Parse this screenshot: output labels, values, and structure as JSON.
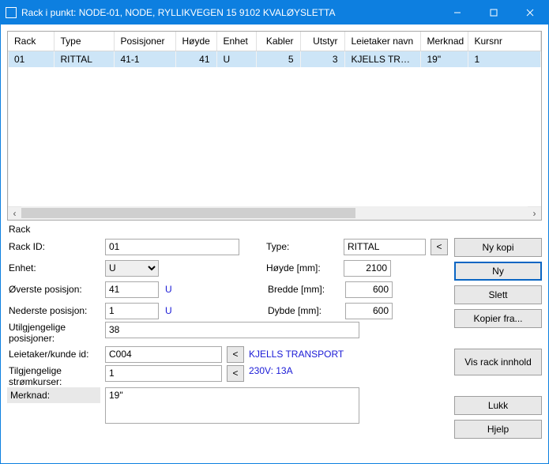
{
  "window": {
    "title": "Rack i punkt: NODE-01, NODE, RYLLIKVEGEN   15 9102 KVALØYSLETTA"
  },
  "grid": {
    "headers": [
      "Rack",
      "Type",
      "Posisjoner",
      "Høyde",
      "Enhet",
      "Kabler",
      "Utstyr",
      "Leietaker navn",
      "Merknad",
      "Kursnr"
    ],
    "row": {
      "rack": "01",
      "type": "RITTAL",
      "posisjoner": "41-1",
      "hoyde": "41",
      "enhet": "U",
      "kabler": "5",
      "utstyr": "3",
      "leietaker": "KJELLS TRAN...",
      "merknad": "19\"",
      "kursnr": "1"
    }
  },
  "labels": {
    "section": "Rack",
    "rack_id": "Rack ID:",
    "enhet": "Enhet:",
    "overste": "Øverste posisjon:",
    "nederste": "Nederste posisjon:",
    "utilgjengelige": "Utilgjengelige posisjoner:",
    "leietaker": "Leietaker/kunde id:",
    "stromkurser": "Tilgjengelige strømkurser:",
    "merknad": "Merknad:",
    "type": "Type:",
    "hoyde": "Høyde [mm]:",
    "bredde": "Bredde [mm]:",
    "dybde": "Dybde [mm]:"
  },
  "values": {
    "rack_id": "01",
    "enhet_option": "U",
    "overste": "41",
    "nederste": "1",
    "unit": "U",
    "utilgjengelige": "38",
    "leietaker_id": "C004",
    "leietaker_name": "KJELLS TRANSPORT",
    "stromkurs": "1",
    "strom_hint": "230V: 13A",
    "merknad": "19\"",
    "type": "RITTAL",
    "hoyde": "2100",
    "bredde": "600",
    "dybde": "600",
    "lt": "<"
  },
  "buttons": {
    "ny_kopi": "Ny kopi",
    "ny": "Ny",
    "slett": "Slett",
    "kopier_fra": "Kopier fra...",
    "vis_rack": "Vis rack innhold",
    "lukk": "Lukk",
    "hjelp": "Hjelp"
  }
}
